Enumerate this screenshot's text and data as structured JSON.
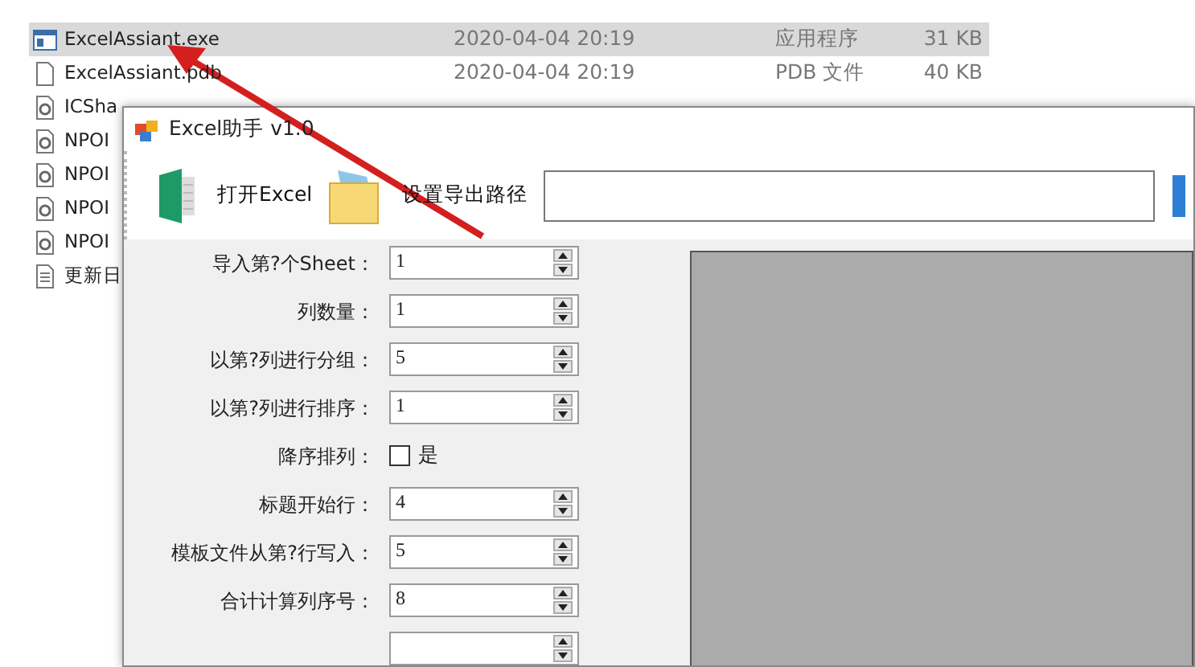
{
  "file_list": {
    "rows": [
      {
        "kind": "exe",
        "name": "ExcelAssiant.exe",
        "date": "2020-04-04 20:19",
        "type": "应用程序",
        "size": "31 KB",
        "selected": true
      },
      {
        "kind": "pdb",
        "name": "ExcelAssiant.pdb",
        "date": "2020-04-04 20:19",
        "type": "PDB 文件",
        "size": "40 KB",
        "selected": false
      },
      {
        "kind": "dll",
        "name": "ICSha",
        "selected": false
      },
      {
        "kind": "dll",
        "name": "NPOI",
        "selected": false
      },
      {
        "kind": "dll",
        "name": "NPOI",
        "selected": false
      },
      {
        "kind": "dll",
        "name": "NPOI",
        "selected": false
      },
      {
        "kind": "dll",
        "name": "NPOI",
        "selected": false
      },
      {
        "kind": "txt",
        "name": "更新日",
        "selected": false
      }
    ]
  },
  "dialog": {
    "title": "Excel助手 v1.0",
    "toolbar": {
      "open_button": "打开Excel",
      "export_path_button": "设置导出路径"
    },
    "settings": [
      {
        "kind": "spinner",
        "label": "导入第?个Sheet：",
        "value": "1"
      },
      {
        "kind": "spinner",
        "label": "列数量：",
        "value": "1"
      },
      {
        "kind": "spinner",
        "label": "以第?列进行分组：",
        "value": "5"
      },
      {
        "kind": "spinner",
        "label": "以第?列进行排序：",
        "value": "1"
      },
      {
        "kind": "checkbox",
        "label": "降序排列：",
        "option": "是",
        "checked": false
      },
      {
        "kind": "spinner",
        "label": "标题开始行：",
        "value": "4"
      },
      {
        "kind": "spinner",
        "label": "模板文件从第?行写入：",
        "value": "5"
      },
      {
        "kind": "spinner",
        "label": "合计计算列序号：",
        "value": "8"
      },
      {
        "kind": "spinner"
      }
    ]
  }
}
